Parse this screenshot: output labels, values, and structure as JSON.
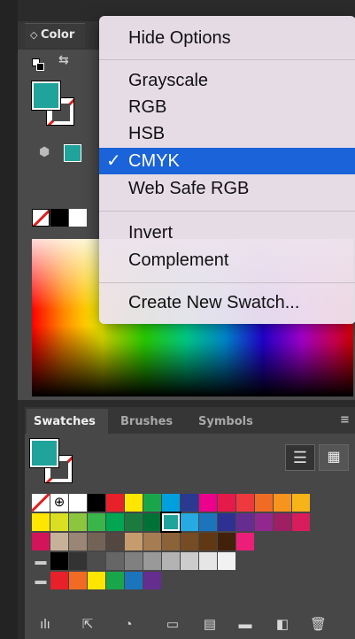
{
  "color_panel": {
    "tab_label": "Color",
    "tab_arrows": "◇"
  },
  "menu": {
    "items": [
      {
        "label": "Hide Options",
        "selected": false
      },
      {
        "label": "Grayscale",
        "selected": false
      },
      {
        "label": "RGB",
        "selected": false
      },
      {
        "label": "HSB",
        "selected": false
      },
      {
        "label": "CMYK",
        "selected": true
      },
      {
        "label": "Web Safe RGB",
        "selected": false
      },
      {
        "label": "Invert",
        "selected": false
      },
      {
        "label": "Complement",
        "selected": false
      },
      {
        "label": "Create New Swatch...",
        "selected": false
      }
    ],
    "check_mark": "✓"
  },
  "swatches_panel": {
    "tabs": [
      "Swatches",
      "Brushes",
      "Symbols"
    ],
    "fill_color": "#1fa39a",
    "row1": [
      "none",
      "reg",
      "#ffffff",
      "#000000",
      "#e8202a",
      "#ffe600",
      "#19a64b",
      "#00a0df",
      "#2b3990",
      "#ec008c",
      "#e6194b",
      "#ee3a3f",
      "#f26b24",
      "#f7941d",
      "#f6b418"
    ],
    "row2": [
      "#ffe600",
      "#d9e021",
      "#8cc63f",
      "#39b54a",
      "#00a651",
      "#1b7b3f",
      "#007236",
      "#1fa39a",
      "#27aae1",
      "#1c75bc",
      "#2e3192",
      "#662d91",
      "#92278f",
      "#9e1f63",
      "#d91c5c"
    ],
    "row3": [
      "#d4145a",
      "#c7b299",
      "#998675",
      "#736357",
      "#534741",
      "#c69c6d",
      "#a67c52",
      "#8c6239",
      "#754c24",
      "#603813",
      "#42210b",
      "#ed1e79"
    ],
    "row4": [
      "#000000",
      "#333333",
      "#4d4d4d",
      "#666666",
      "#808080",
      "#999999",
      "#b3b3b3",
      "#cccccc",
      "#e6e6e6",
      "#f2f2f2"
    ],
    "row5": [
      "#e8202a",
      "#f26b24",
      "#ffe600",
      "#19a64b",
      "#1c75bc",
      "#662d91"
    ]
  }
}
